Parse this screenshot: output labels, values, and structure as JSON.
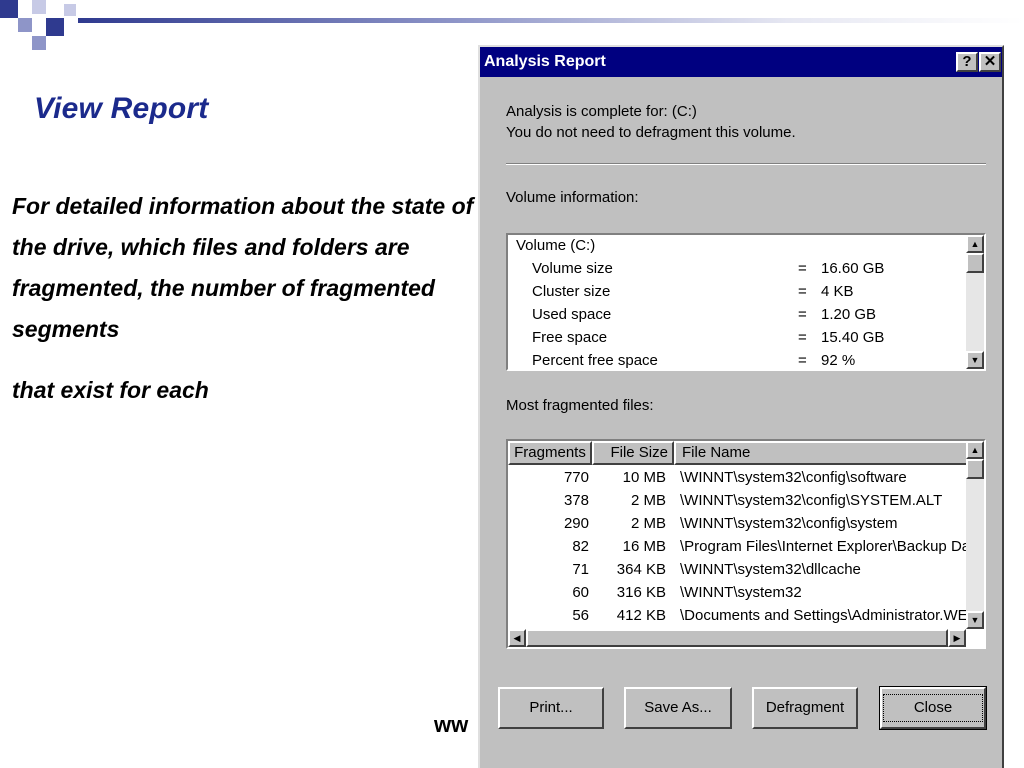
{
  "slide": {
    "title": "View Report",
    "body_para1": "For detailed information about the state of the drive, which files and folders are fragmented, the number of fragmented segments",
    "body_para2": "that exist for each",
    "footer_fragment": "ww"
  },
  "dialog": {
    "title": "Analysis Report",
    "help_glyph": "?",
    "close_glyph": "✕",
    "status_line1": "Analysis is complete for: (C:)",
    "status_line2": "You do not need to defragment this volume.",
    "volume_info_label": "Volume information:",
    "volume_header": "Volume  (C:)",
    "volume_rows": [
      {
        "label": "Volume size",
        "eq": "=",
        "value": "16.60 GB"
      },
      {
        "label": "Cluster size",
        "eq": "=",
        "value": "4 KB"
      },
      {
        "label": "Used space",
        "eq": "=",
        "value": "1.20 GB"
      },
      {
        "label": "Free space",
        "eq": "=",
        "value": "15.40 GB"
      },
      {
        "label": "Percent free space",
        "eq": "=",
        "value": "92 %"
      }
    ],
    "fragmented_label": "Most fragmented files:",
    "columns": [
      "Fragments",
      "File Size",
      "File Name"
    ],
    "files": [
      {
        "fragments": "770",
        "size": "10 MB",
        "name": "\\WINNT\\system32\\config\\software"
      },
      {
        "fragments": "378",
        "size": "2 MB",
        "name": "\\WINNT\\system32\\config\\SYSTEM.ALT"
      },
      {
        "fragments": "290",
        "size": "2 MB",
        "name": "\\WINNT\\system32\\config\\system"
      },
      {
        "fragments": "82",
        "size": "16 MB",
        "name": "\\Program Files\\Internet Explorer\\Backup Data.."
      },
      {
        "fragments": "71",
        "size": "364 KB",
        "name": "\\WINNT\\system32\\dllcache"
      },
      {
        "fragments": "60",
        "size": "316 KB",
        "name": "\\WINNT\\system32"
      },
      {
        "fragments": "56",
        "size": "412 KB",
        "name": "\\Documents and Settings\\Administrator.WES"
      }
    ],
    "buttons": {
      "print": "Print...",
      "save_as": "Save As...",
      "defragment": "Defragment",
      "close": "Close"
    }
  }
}
